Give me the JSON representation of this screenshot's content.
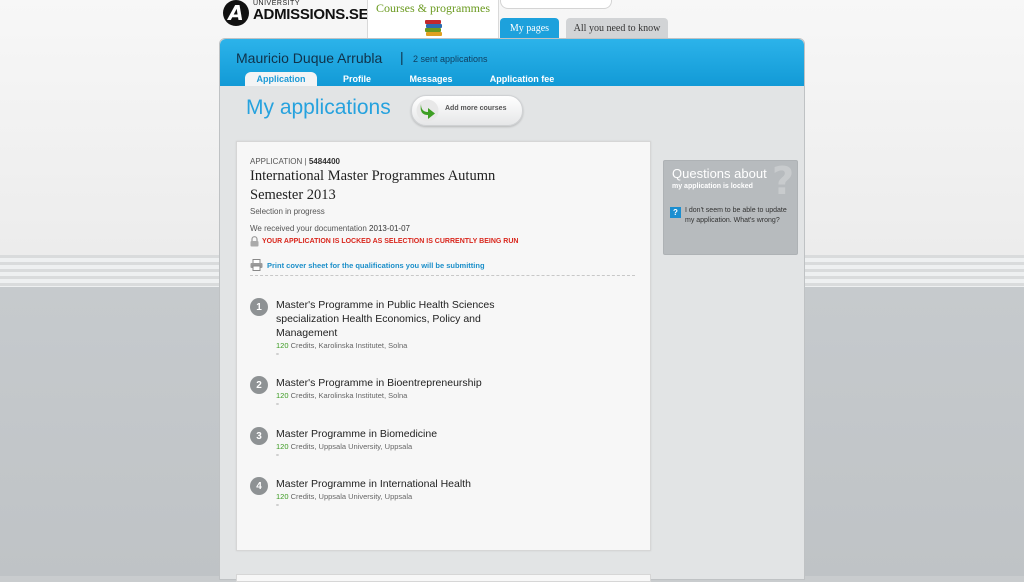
{
  "header": {
    "logo_small": "UNIVERSITY",
    "logo_big": "ADMISSIONS.SE",
    "courses_tab": "Courses & programmes",
    "my_pages_tab": "My pages",
    "all_you_need_tab": "All you need to know"
  },
  "user": {
    "name": "Mauricio Duque Arrubla",
    "separator": "|",
    "sent": "2 sent applications"
  },
  "subtabs": [
    "Application",
    "Profile",
    "Messages",
    "Application fee"
  ],
  "page": {
    "title": "My applications",
    "add_more": "Add more courses"
  },
  "application": {
    "label": "APPLICATION",
    "separator": "|",
    "number": "5484400",
    "title": "International Master Programmes Autumn Semester 2013",
    "status": "Selection in progress",
    "received_label": "We received your documentation",
    "received_date": "2013-01-07",
    "locked_text": "YOUR APPLICATION IS LOCKED AS SELECTION IS CURRENTLY BEING RUN",
    "print_text": "Print cover sheet for the qualifications you will be submitting"
  },
  "programmes": [
    {
      "num": "1",
      "name": "Master's Programme in Public Health Sciences specialization Health Economics, Policy and Management",
      "credits": "120",
      "meta": "Credits, Karolinska Institutet, Solna",
      "tick": "="
    },
    {
      "num": "2",
      "name": "Master's Programme in Bioentrepreneurship",
      "credits": "120",
      "meta": "Credits, Karolinska Institutet, Solna",
      "tick": "="
    },
    {
      "num": "3",
      "name": "Master Programme in Biomedicine",
      "credits": "120",
      "meta": "Credits, Uppsala University, Uppsala",
      "tick": "="
    },
    {
      "num": "4",
      "name": "Master Programme in International Health",
      "credits": "120",
      "meta": "Credits, Uppsala University, Uppsala",
      "tick": "="
    }
  ],
  "questions": {
    "title": "Questions about",
    "subtitle": "my application is locked",
    "q_icon": "?",
    "item": "I don't seem to be able to update my application. What's wrong?"
  },
  "colors": {
    "brand_blue": "#1da1dc",
    "title_blue": "#26a2de",
    "lock_red": "#d9261c",
    "credits_green": "#3a9a1f"
  }
}
